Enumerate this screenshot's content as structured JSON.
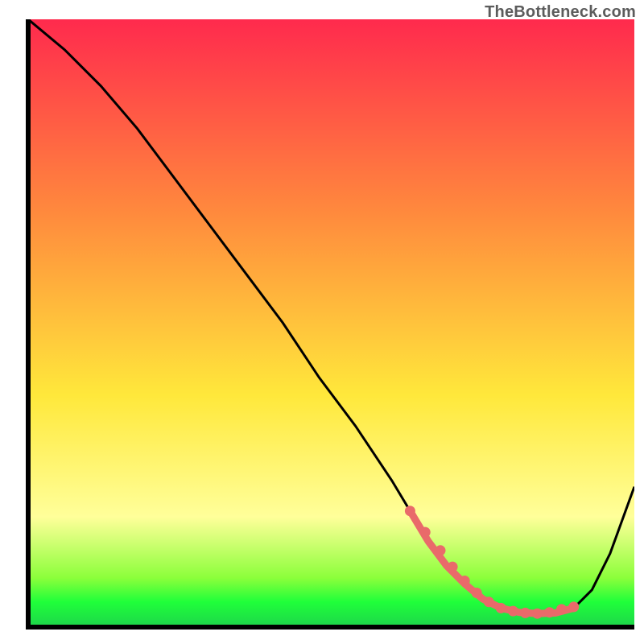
{
  "attribution": "TheBottleneck.com",
  "colors": {
    "gradient_top": "#ff2a4d",
    "gradient_mid_orange": "#ff8a3d",
    "gradient_mid_yellow": "#ffe83b",
    "gradient_pale_yellow": "#ffff9a",
    "gradient_green_light": "#8cff3b",
    "gradient_green": "#1fff3a",
    "gradient_green_dark": "#1ed64a",
    "curve_stroke": "#000000",
    "highlight_stroke": "#e96a6a",
    "highlight_dot": "#e96a6a",
    "axis_stroke": "#000000"
  },
  "chart_data": {
    "type": "line",
    "title": "",
    "xlabel": "",
    "ylabel": "",
    "xlim": [
      0,
      100
    ],
    "ylim": [
      0,
      100
    ],
    "grid": false,
    "legend": false,
    "series": [
      {
        "name": "bottleneck-curve",
        "x": [
          0,
          6,
          12,
          18,
          24,
          30,
          36,
          42,
          48,
          54,
          60,
          63,
          66,
          69,
          72,
          75,
          78,
          81,
          84,
          87,
          90,
          93,
          96,
          100
        ],
        "y": [
          100,
          95,
          89,
          82,
          74,
          66,
          58,
          50,
          41,
          33,
          24,
          19,
          14,
          10,
          7,
          4.5,
          3,
          2.3,
          2.1,
          2.2,
          3,
          6,
          12,
          23
        ]
      }
    ],
    "highlight_region": {
      "x_start": 63,
      "x_end": 90,
      "band_thickness": 4,
      "note": "salmon dotted segment along the curve near its minimum"
    },
    "highlight_dots": {
      "x": [
        63,
        65.5,
        68,
        70,
        72,
        74,
        76,
        78,
        80,
        82,
        84,
        86,
        88,
        90
      ],
      "y": [
        19,
        15.5,
        12.5,
        9.8,
        7.5,
        5.5,
        4,
        3,
        2.5,
        2.2,
        2.1,
        2.3,
        2.8,
        3.2
      ]
    }
  }
}
